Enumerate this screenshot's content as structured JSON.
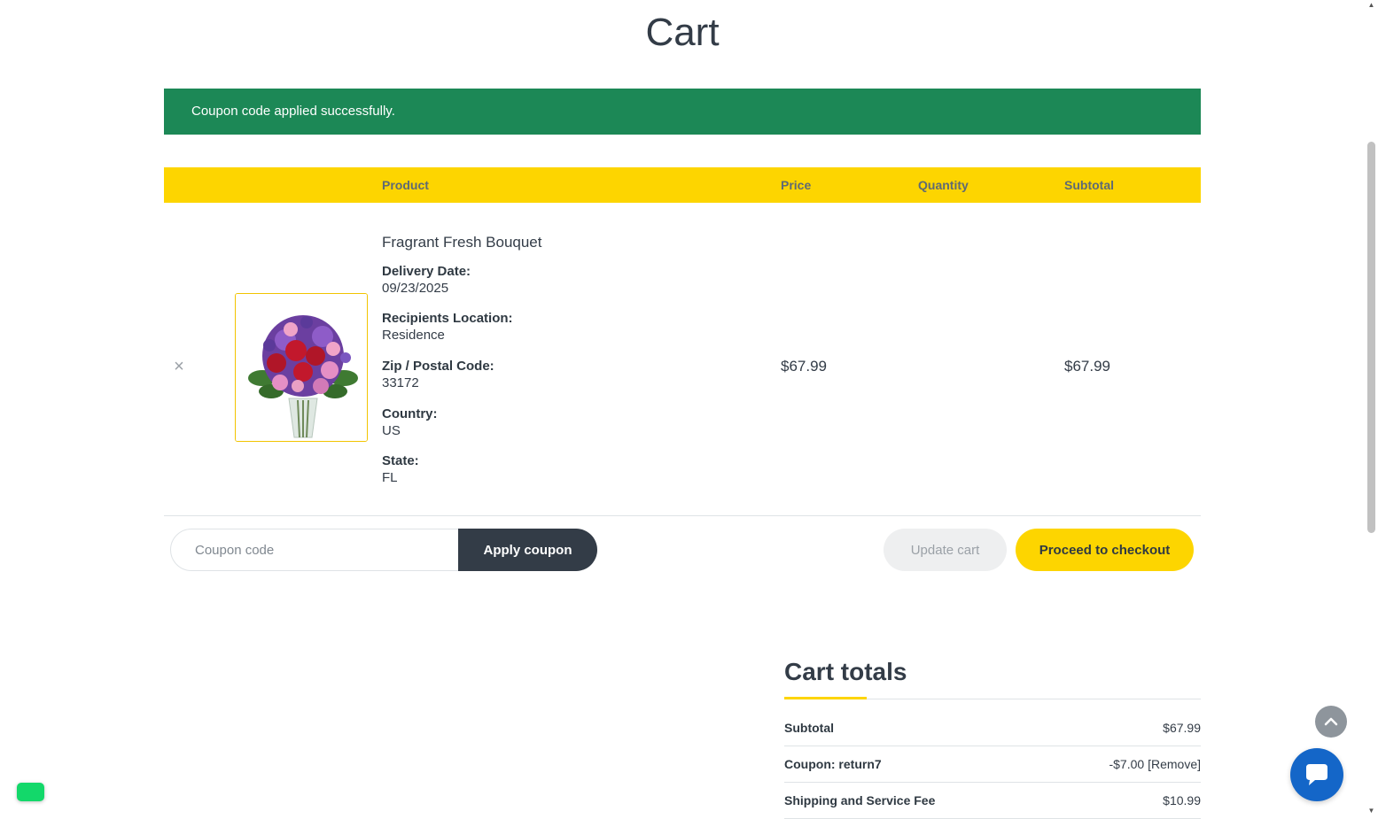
{
  "page": {
    "title": "Cart"
  },
  "notice": {
    "message": "Coupon code applied successfully.",
    "color": "#1c8856"
  },
  "table": {
    "headers": {
      "product": "Product",
      "price": "Price",
      "quantity": "Quantity",
      "subtotal": "Subtotal"
    },
    "header_color": "#fdd500"
  },
  "item": {
    "remove_icon": "close-icon",
    "remove_glyph": "×",
    "name": "Fragrant Fresh Bouquet",
    "meta": [
      {
        "label": "Delivery Date:",
        "value": "09/23/2025"
      },
      {
        "label": "Recipients Location:",
        "value": "Residence"
      },
      {
        "label": "Zip / Postal Code:",
        "value": "33172"
      },
      {
        "label": "Country:",
        "value": "US"
      },
      {
        "label": "State:",
        "value": "FL"
      }
    ],
    "price": "$67.99",
    "subtotal": "$67.99"
  },
  "actions": {
    "coupon_placeholder": "Coupon code",
    "apply_label": "Apply coupon",
    "update_label": "Update cart",
    "checkout_label": "Proceed to checkout"
  },
  "totals": {
    "title": "Cart totals",
    "rows": [
      {
        "label": "Subtotal",
        "value": "$67.99"
      },
      {
        "label": "Coupon: return7",
        "value": "-$7.00",
        "link": "[Remove]"
      },
      {
        "label": "Shipping and Service Fee",
        "value": "$10.99"
      }
    ]
  },
  "widgets": {
    "back_to_top_icon": "chevron-up-icon",
    "chat_icon": "chat-bubble-icon"
  }
}
